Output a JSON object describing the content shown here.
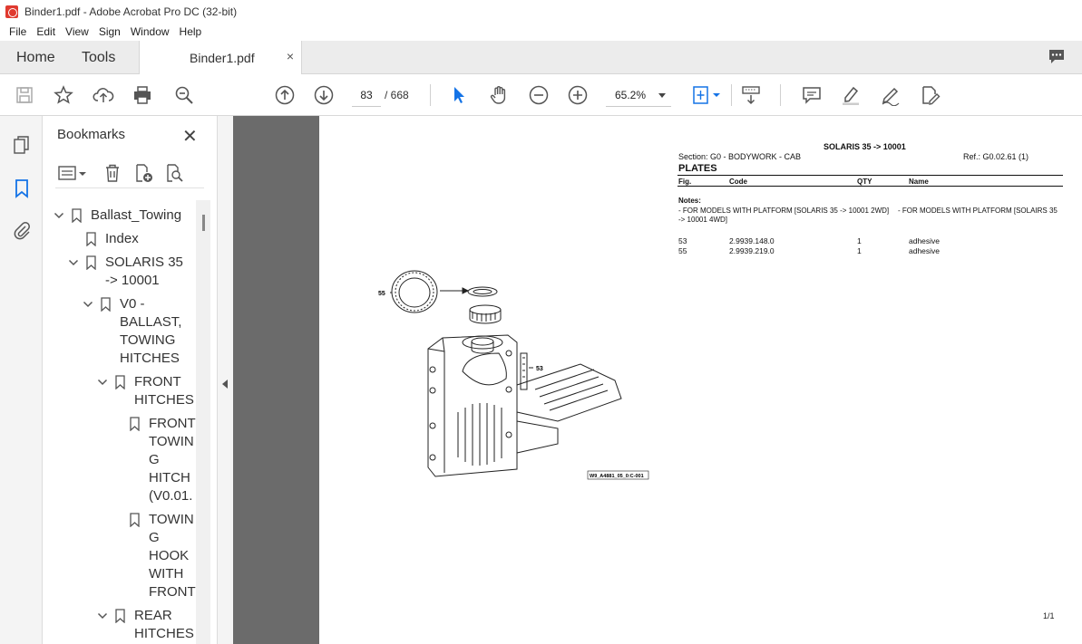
{
  "window": {
    "title": "Binder1.pdf - Adobe Acrobat Pro DC (32-bit)"
  },
  "menu": [
    "File",
    "Edit",
    "View",
    "Sign",
    "Window",
    "Help"
  ],
  "tabs": {
    "home": "Home",
    "tools": "Tools",
    "document": "Binder1.pdf",
    "close": "×"
  },
  "toolbar": {
    "page_current": "83",
    "page_total": "/ 668",
    "zoom": "65.2%"
  },
  "bookmarks": {
    "title": "Bookmarks",
    "close": "✕",
    "items": [
      {
        "label": "Ballast_Towing",
        "level": 0,
        "expanded": true
      },
      {
        "label": "Index",
        "level": 1,
        "expanded": null
      },
      {
        "label": "SOLARIS 35\n-> 10001",
        "level": 1,
        "expanded": true
      },
      {
        "label": "V0 -\nBALLAST,\nTOWING\nHITCHES",
        "level": 2,
        "expanded": true
      },
      {
        "label": "FRONT\nHITCHES",
        "level": 3,
        "expanded": true
      },
      {
        "label": "FRONT\nTOWIN\nG\nHITCH\n(V0.01.",
        "level": 4,
        "expanded": null
      },
      {
        "label": "TOWIN\nG\nHOOK\nWITH\nFRONT",
        "level": 4,
        "expanded": null
      },
      {
        "label": "REAR\nHITCHES",
        "level": 3,
        "expanded": true
      }
    ]
  },
  "document": {
    "header": "SOLARIS 35 -> 10001",
    "section": "Section: G0 - BODYWORK - CAB",
    "ref": "Ref.: G0.02.61 (1)",
    "subtitle": "PLATES",
    "columns": {
      "fig": "Fig.",
      "code": "Code",
      "qty": "QTY",
      "name": "Name"
    },
    "notes_label": "Notes:",
    "note_a": "- FOR MODELS WITH PLATFORM [SOLARIS 35 -> 10001 2WD]",
    "note_b1": "- FOR MODELS WITH PLATFORM [SOLAIRS 35",
    "note_b2": "-> 10001 4WD]",
    "rows": [
      {
        "fig": "53",
        "code": "2.9939.148.0",
        "qty": "1",
        "name": "adhesive"
      },
      {
        "fig": "55",
        "code": "2.9939.219.0",
        "qty": "1",
        "name": "adhesive"
      }
    ],
    "callout_55": "55",
    "callout_53": "53",
    "drawing_id": "W9_A4881_05_0:C-001",
    "page_number": "1/1"
  }
}
